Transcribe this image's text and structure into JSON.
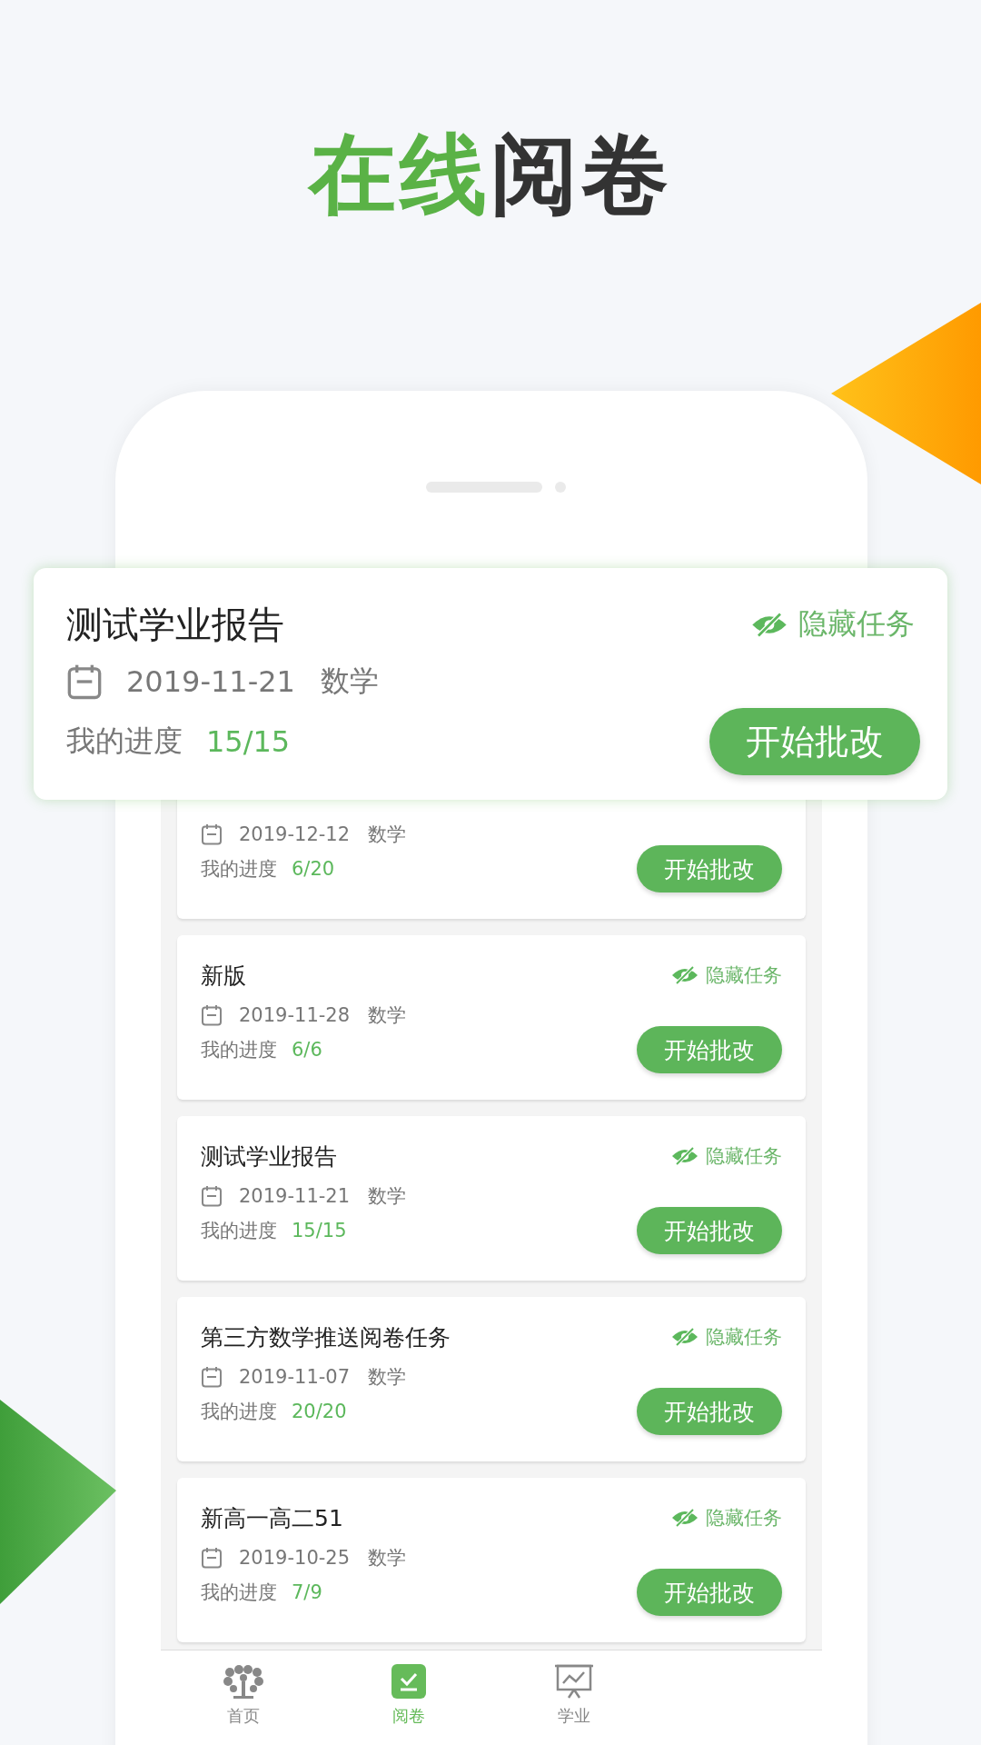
{
  "headline": [
    {
      "text": "在线",
      "accent": true
    },
    {
      "text": "阅卷",
      "accent": false
    }
  ],
  "featured_task": {
    "title": "测试学业报告",
    "date": "2019-11-21",
    "subject": "数学",
    "progress_label": "我的进度",
    "progress": "15/15",
    "hide_label": "隐藏任务",
    "button": "开始批改"
  },
  "tasks": [
    {
      "date": "2019-12-12",
      "subject": "数学",
      "progress_label": "我的进度",
      "progress": "6/20",
      "button": "开始批改"
    },
    {
      "title": "新版",
      "date": "2019-11-28",
      "subject": "数学",
      "progress_label": "我的进度",
      "progress": "6/6",
      "hide_label": "隐藏任务",
      "button": "开始批改"
    },
    {
      "title": "测试学业报告",
      "date": "2019-11-21",
      "subject": "数学",
      "progress_label": "我的进度",
      "progress": "15/15",
      "hide_label": "隐藏任务",
      "button": "开始批改"
    },
    {
      "title": "第三方数学推送阅卷任务",
      "date": "2019-11-07",
      "subject": "数学",
      "progress_label": "我的进度",
      "progress": "20/20",
      "hide_label": "隐藏任务",
      "button": "开始批改"
    },
    {
      "title": "新高一高二51",
      "date": "2019-10-25",
      "subject": "数学",
      "progress_label": "我的进度",
      "progress": "7/9",
      "hide_label": "隐藏任务",
      "button": "开始批改"
    }
  ],
  "nav": [
    {
      "kind": "home",
      "label": "首页",
      "selected": false
    },
    {
      "kind": "grading",
      "label": "阅卷",
      "selected": true
    },
    {
      "kind": "report",
      "label": "学业",
      "selected": false
    }
  ]
}
